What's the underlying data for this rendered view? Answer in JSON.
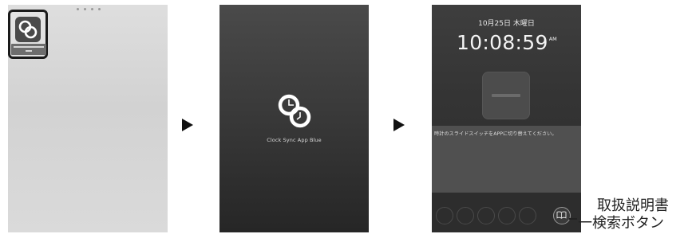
{
  "home_screen": {
    "app_icon": "clock-sync-logo-icon"
  },
  "splash_screen": {
    "logo_icon": "clock-sync-logo-icon",
    "app_title": "Clock Sync App Blue"
  },
  "clock_screen": {
    "date": "10月25日 木曜日",
    "time": "10:08:59",
    "ampm": "AM",
    "instruction": "時計のスライドスイッチをAPPに切り替えてください。",
    "manual_button_icon": "book-icon"
  },
  "callout": {
    "line1": "取扱説明書",
    "line2": "一検索ボタン"
  },
  "colors": {
    "home_bg": "#d6d6d6",
    "app_dark_bg": "#2c2c2c",
    "highlight_border": "#1a1a1a"
  }
}
